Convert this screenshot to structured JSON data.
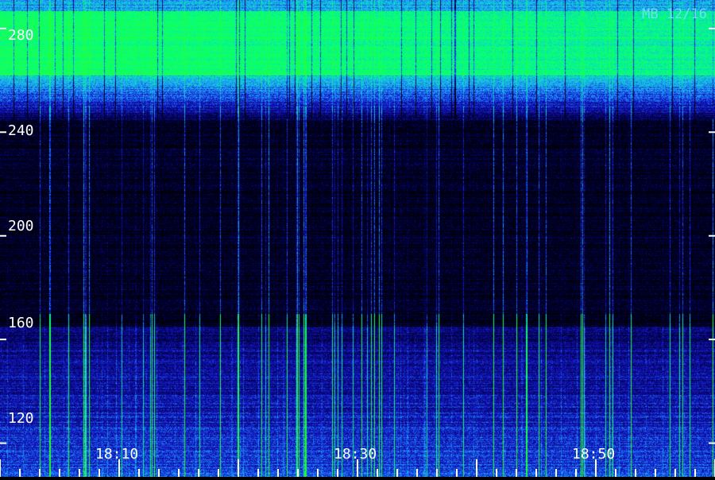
{
  "stamp": "MB 12/16",
  "colors": {
    "background": "#000000",
    "low": "#1a1aa0",
    "mid": "#1e90ff",
    "high": "#22ff88",
    "tick": "#ffffff"
  },
  "chart_data": {
    "type": "heatmap",
    "title": "",
    "xlabel": "",
    "ylabel": "",
    "y_ticks": [
      "120",
      "160",
      "200",
      "240",
      "280"
    ],
    "y_tick_values": [
      120,
      160,
      200,
      240,
      280
    ],
    "ylim": [
      107,
      291
    ],
    "x_ticks": [
      "18:10",
      "18:30",
      "18:50"
    ],
    "xlim": [
      "18:02",
      "19:00"
    ],
    "bands": [
      {
        "y_from": 262,
        "y_to": 287,
        "level": "high"
      },
      {
        "y_from": 245,
        "y_to": 262,
        "level": "mid"
      },
      {
        "y_from": 110,
        "y_to": 165,
        "level": "mid-low"
      }
    ],
    "grid": false,
    "legend": "none"
  }
}
